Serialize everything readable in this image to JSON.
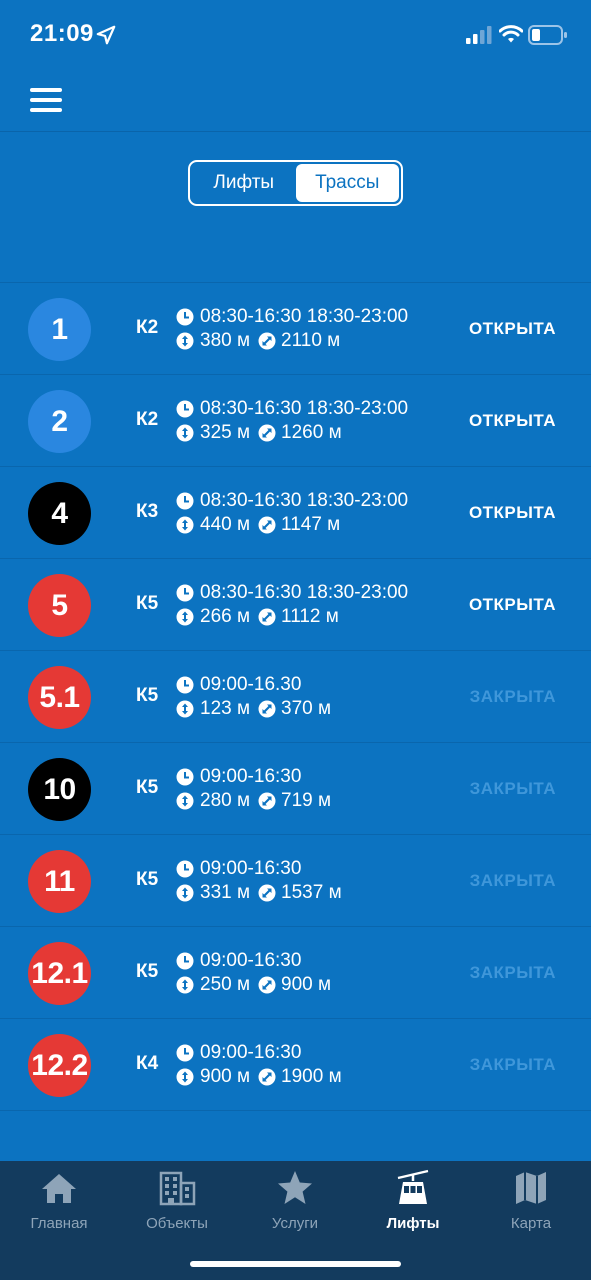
{
  "status_bar": {
    "time": "21:09"
  },
  "segmented": {
    "tab_lifts": "Лифты",
    "tab_trails": "Трассы"
  },
  "colors": {
    "background": "#0c73c1",
    "blue": "#2a87e0",
    "black": "#000000",
    "red": "#e53935",
    "closed_text": "#3f97da",
    "tabbar": "#133b5e"
  },
  "lifts": [
    {
      "number": "1",
      "color": "blue",
      "line": "К2",
      "hours": "08:30-16:30 18:30-23:00",
      "vertical": "380 м",
      "length": "2110 м",
      "status": "ОТКРЫТА",
      "open": true
    },
    {
      "number": "2",
      "color": "blue",
      "line": "К2",
      "hours": "08:30-16:30 18:30-23:00",
      "vertical": "325 м",
      "length": "1260 м",
      "status": "ОТКРЫТА",
      "open": true
    },
    {
      "number": "4",
      "color": "black",
      "line": "К3",
      "hours": "08:30-16:30 18:30-23:00",
      "vertical": "440 м",
      "length": "1147 м",
      "status": "ОТКРЫТА",
      "open": true
    },
    {
      "number": "5",
      "color": "red",
      "line": "К5",
      "hours": "08:30-16:30 18:30-23:00",
      "vertical": "266 м",
      "length": "1112 м",
      "status": "ОТКРЫТА",
      "open": true
    },
    {
      "number": "5.1",
      "color": "red",
      "line": "К5",
      "hours": "09:00-16.30",
      "vertical": "123 м",
      "length": "370 м",
      "status": "ЗАКРЫТА",
      "open": false
    },
    {
      "number": "10",
      "color": "black",
      "line": "К5",
      "hours": "09:00-16:30",
      "vertical": "280 м",
      "length": "719 м",
      "status": "ЗАКРЫТА",
      "open": false
    },
    {
      "number": "11",
      "color": "red",
      "line": "К5",
      "hours": "09:00-16:30",
      "vertical": "331 м",
      "length": "1537 м",
      "status": "ЗАКРЫТА",
      "open": false
    },
    {
      "number": "12.1",
      "color": "red",
      "line": "К5",
      "hours": "09:00-16:30",
      "vertical": "250 м",
      "length": "900 м",
      "status": "ЗАКРЫТА",
      "open": false
    },
    {
      "number": "12.2",
      "color": "red",
      "line": "К4",
      "hours": "09:00-16:30",
      "vertical": "900 м",
      "length": "1900 м",
      "status": "ЗАКРЫТА",
      "open": false
    }
  ],
  "tabbar": {
    "items": [
      {
        "label": "Главная",
        "icon": "home-icon"
      },
      {
        "label": "Объекты",
        "icon": "building-icon"
      },
      {
        "label": "Услуги",
        "icon": "star-icon"
      },
      {
        "label": "Лифты",
        "icon": "cable-car-icon",
        "active": true
      },
      {
        "label": "Карта",
        "icon": "map-icon"
      }
    ]
  }
}
